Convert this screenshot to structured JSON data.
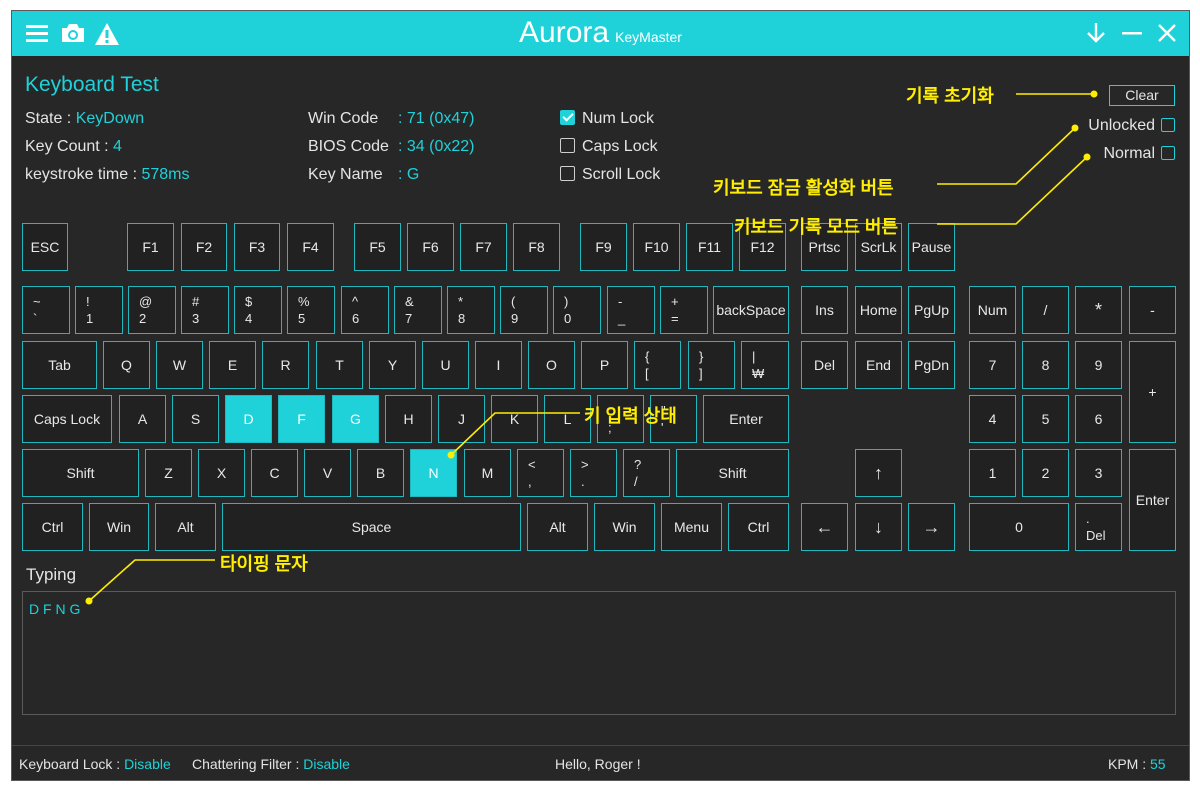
{
  "app": {
    "title": "Aurora",
    "subtitle": "KeyMaster"
  },
  "page_title": "Keyboard Test",
  "info": {
    "state_label": "State : ",
    "state_value": "KeyDown",
    "count_label": "Key Count : ",
    "count_value": "4",
    "time_label": "keystroke time : ",
    "time_value": "578ms",
    "wincode_label": "Win Code",
    "wincode_value": ": 71 (0x47)",
    "bios_label": "BIOS Code",
    "bios_value": ": 34 (0x22)",
    "name_label": "Key Name",
    "name_value": ": G"
  },
  "locks": {
    "num": "Num Lock",
    "caps": "Caps Lock",
    "scroll": "Scroll Lock"
  },
  "right_controls": {
    "clear": "Clear",
    "unlocked": "Unlocked",
    "normal": "Normal"
  },
  "keys": {
    "esc": "ESC",
    "f1": "F1",
    "f2": "F2",
    "f3": "F3",
    "f4": "F4",
    "f5": "F5",
    "f6": "F6",
    "f7": "F7",
    "f8": "F8",
    "f9": "F9",
    "f10": "F10",
    "f11": "F11",
    "f12": "F12",
    "prtsc": "Prtsc",
    "scrlk": "ScrLk",
    "pause": "Pause",
    "tilde_top": "~",
    "tilde_bot": "`",
    "n1_top": "!",
    "n1_bot": "1",
    "n2_top": "@",
    "n2_bot": "2",
    "n3_top": "#",
    "n3_bot": "3",
    "n4_top": "$",
    "n4_bot": "4",
    "n5_top": "%",
    "n5_bot": "5",
    "n6_top": "^",
    "n6_bot": "6",
    "n7_top": "&",
    "n7_bot": "7",
    "n8_top": "*",
    "n8_bot": "8",
    "n9_top": "(",
    "n9_bot": "9",
    "n0_top": ")",
    "n0_bot": "0",
    "minus_top": "-",
    "minus_bot": "_",
    "plus_top": "+",
    "plus_bot": "=",
    "backspace": "backSpace",
    "ins": "Ins",
    "home": "Home",
    "pgup": "PgUp",
    "num": "Num",
    "kp_div": "/",
    "kp_mul": "*",
    "kp_sub": "-",
    "tab": "Tab",
    "q": "Q",
    "w": "W",
    "e": "E",
    "r": "R",
    "t": "T",
    "y": "Y",
    "u": "U",
    "i": "I",
    "o": "O",
    "p": "P",
    "lbr_top": "{",
    "lbr_bot": "[",
    "rbr_top": "}",
    "rbr_bot": "]",
    "won_top": "|",
    "won_bot": "₩",
    "del": "Del",
    "end": "End",
    "pgdn": "PgDn",
    "kp7": "7",
    "kp8": "8",
    "kp9": "9",
    "kp_add": "+",
    "caps": "Caps Lock",
    "a": "A",
    "s": "S",
    "d": "D",
    "f": "F",
    "g": "G",
    "h": "H",
    "j": "J",
    "k": "K",
    "l": "L",
    "semi_top": ":",
    "semi_bot": ";",
    "quote_top": "\"",
    "quote_bot": "'",
    "enter": "Enter",
    "kp4": "4",
    "kp5": "5",
    "kp6": "6",
    "lshift": "Shift",
    "z": "Z",
    "x": "X",
    "c": "C",
    "v": "V",
    "b": "B",
    "n": "N",
    "m": "M",
    "comma_top": "<",
    "comma_bot": ",",
    "dot_top": ">",
    "dot_bot": ".",
    "slash_top": "?",
    "slash_bot": "/",
    "rshift": "Shift",
    "up": "↑",
    "kp1": "1",
    "kp2": "2",
    "kp3": "3",
    "kp_enter": "Enter",
    "lctrl": "Ctrl",
    "lwin": "Win",
    "lalt": "Alt",
    "space": "Space",
    "ralt": "Alt",
    "rwin": "Win",
    "menu": "Menu",
    "rctrl": "Ctrl",
    "left": "←",
    "down": "↓",
    "right": "→",
    "kp0": "0",
    "kp_dot_top": ".",
    "kp_dot_bot": "Del"
  },
  "pressed_keys": [
    "D",
    "F",
    "G",
    "N"
  ],
  "typing": {
    "label": "Typing",
    "text": "D F N G"
  },
  "status": {
    "lock_label": "Keyboard Lock : ",
    "lock_value": "Disable",
    "chatter_label": "Chattering Filter : ",
    "chatter_value": "Disable",
    "greeting": "Hello, Roger !",
    "kpm_label": "KPM : ",
    "kpm_value": "55"
  },
  "annotations": {
    "clear": "기록 초기화",
    "lock": "키보드 잠금 활성화 버튼",
    "mode": "키보드 기록 모드 버튼",
    "keystate": "키 입력 상태",
    "typing": "타이핑 문자"
  },
  "colors": {
    "accent": "#1fd2d9",
    "annotation": "#ffee00",
    "background": "#272727"
  },
  "icons": [
    "menu-icon",
    "camera-icon",
    "warning-icon",
    "download-icon",
    "minimize-icon",
    "close-icon"
  ]
}
